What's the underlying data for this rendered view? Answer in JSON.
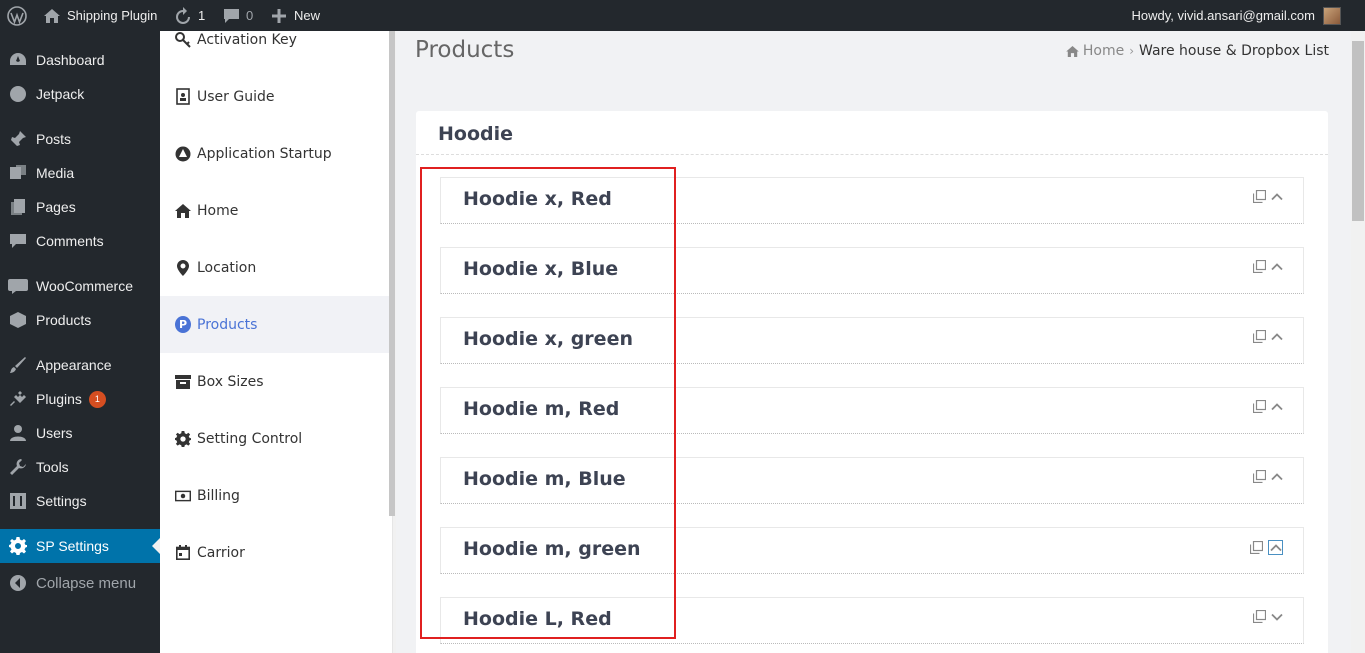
{
  "adminbar": {
    "site_name": "Shipping Plugin",
    "updates_count": "1",
    "comments_count": "0",
    "new_label": "New",
    "greeting": "Howdy, vivid.ansari@gmail.com"
  },
  "wp_menu": {
    "items": [
      {
        "label": "Dashboard",
        "icon": "dashboard-icon"
      },
      {
        "label": "Jetpack",
        "icon": "jetpack-icon"
      },
      {
        "label": "Posts",
        "icon": "pin-icon"
      },
      {
        "label": "Media",
        "icon": "media-icon"
      },
      {
        "label": "Pages",
        "icon": "pages-icon"
      },
      {
        "label": "Comments",
        "icon": "comments-icon"
      },
      {
        "label": "WooCommerce",
        "icon": "woo-icon"
      },
      {
        "label": "Products",
        "icon": "box-icon"
      },
      {
        "label": "Appearance",
        "icon": "brush-icon"
      },
      {
        "label": "Plugins",
        "icon": "plug-icon",
        "badge": "1"
      },
      {
        "label": "Users",
        "icon": "user-icon"
      },
      {
        "label": "Tools",
        "icon": "wrench-icon"
      },
      {
        "label": "Settings",
        "icon": "sliders-icon"
      },
      {
        "label": "SP Settings",
        "icon": "gear-icon"
      }
    ],
    "collapse_label": "Collapse menu"
  },
  "plugin_nav": {
    "items": [
      {
        "label": "Activation Key"
      },
      {
        "label": "User Guide"
      },
      {
        "label": "Application Startup"
      },
      {
        "label": "Home"
      },
      {
        "label": "Location"
      },
      {
        "label": "Products"
      },
      {
        "label": "Box Sizes"
      },
      {
        "label": "Setting Control"
      },
      {
        "label": "Billing"
      },
      {
        "label": "Carrior"
      }
    ],
    "active_index": 5
  },
  "main": {
    "title": "Products",
    "breadcrumb": {
      "home": "Home",
      "current": "Ware house & Dropbox List"
    },
    "card_title": "Hoodie",
    "products": [
      {
        "name": "Hoodie x, Red"
      },
      {
        "name": "Hoodie x, Blue"
      },
      {
        "name": "Hoodie x, green"
      },
      {
        "name": "Hoodie m, Red"
      },
      {
        "name": "Hoodie m, Blue"
      },
      {
        "name": "Hoodie m, green"
      },
      {
        "name": "Hoodie L, Red"
      }
    ]
  },
  "colors": {
    "wp_dark": "#23282d",
    "wp_active": "#0073aa",
    "plugin_accent": "#4a73d6",
    "highlight": "#e02020"
  }
}
